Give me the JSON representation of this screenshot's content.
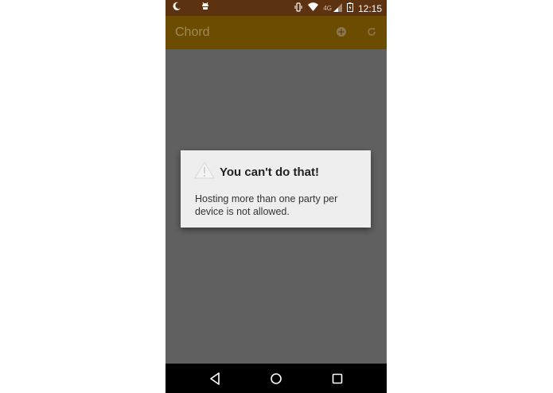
{
  "status_bar": {
    "time": "12:15",
    "network_label": "4G",
    "icons": [
      "moon-icon",
      "android-icon",
      "vibrate-icon",
      "wifi-icon",
      "signal-icon",
      "battery-charging-icon"
    ]
  },
  "app_bar": {
    "title": "Chord",
    "actions": [
      "add-icon",
      "refresh-icon"
    ]
  },
  "dialog": {
    "title": "You can't do that!",
    "icon": "warning-icon",
    "message": "Hosting more than one party per device is not allowed."
  },
  "nav_bar": {
    "buttons": [
      "back-icon",
      "home-icon",
      "recents-icon"
    ]
  },
  "colors": {
    "status_bar": "#5c3210",
    "app_bar": "#6b4c00",
    "scrim": "#616161",
    "dialog": "#eeeeee"
  }
}
